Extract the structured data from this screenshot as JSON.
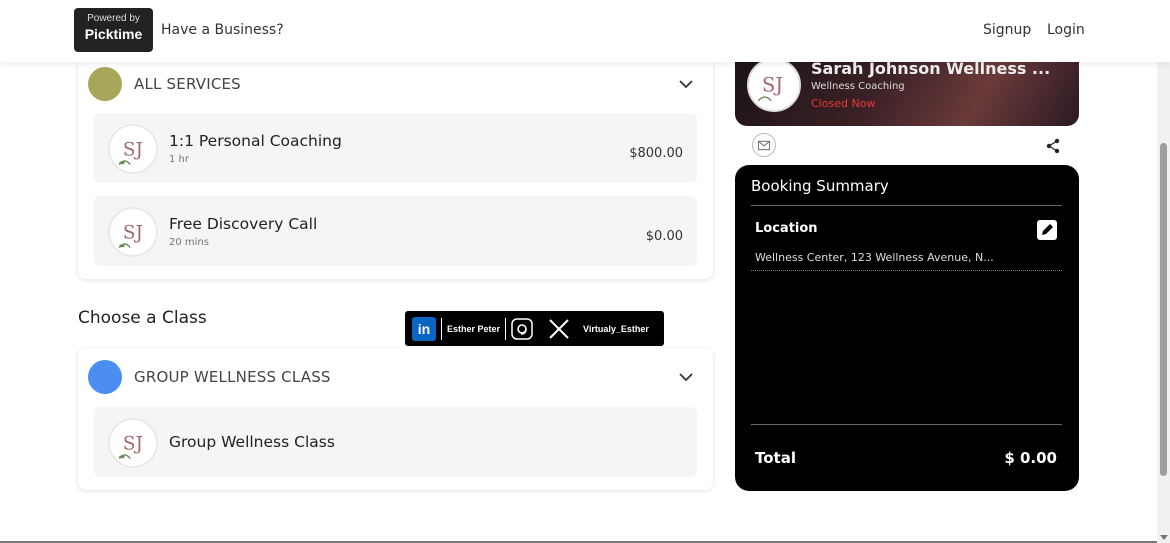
{
  "header": {
    "powered_by": "Powered by",
    "brand": "Picktime",
    "business_prompt": "Have a Business?",
    "signup": "Signup",
    "login": "Login"
  },
  "categories": [
    {
      "label": "ALL SERVICES",
      "dot_color": "#a8a65a",
      "services": [
        {
          "name": "1:1 Personal Coaching",
          "duration": "1 hr",
          "price": "$800.00"
        },
        {
          "name": "Free Discovery Call",
          "duration": "20 mins",
          "price": "$0.00"
        }
      ]
    }
  ],
  "classes_section": {
    "title": "Choose a Class",
    "category": {
      "label": "GROUP WELLNESS CLASS",
      "dot_color": "#4b8ef0",
      "items": [
        {
          "name": "Group Wellness Class"
        }
      ]
    }
  },
  "social_banner": {
    "linkedin_name": "Esther Peter",
    "x_handle": "Virtualy_Esther"
  },
  "business": {
    "name": "Sarah Johnson Wellness ...",
    "category": "Wellness Coaching",
    "status": "Closed Now",
    "status_color": "#e53935",
    "logo_initials": "SJ"
  },
  "booking_summary": {
    "title": "Booking Summary",
    "location_label": "Location",
    "location_address": "Wellness Center, 123 Wellness Avenue, N...",
    "total_label": "Total",
    "total_value": "$ 0.00"
  },
  "icons": {
    "chevron": "chevron-down-icon",
    "mail": "mail-icon",
    "share": "share-icon",
    "edit": "pencil-icon",
    "linkedin": "linkedin-icon",
    "threads": "threads-icon",
    "x": "x-logo-icon"
  }
}
